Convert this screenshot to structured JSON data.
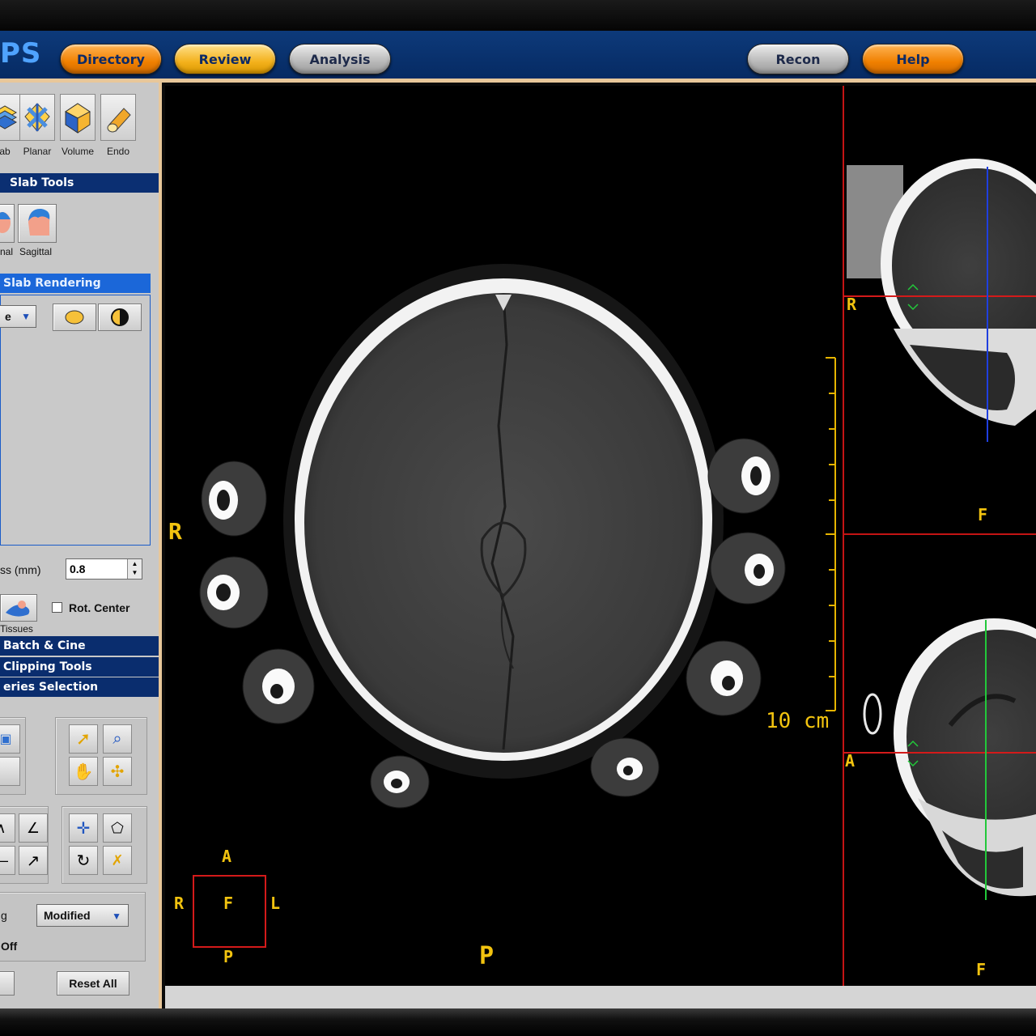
{
  "header": {
    "logo_text": "PS",
    "nav_buttons": [
      {
        "label": "Directory",
        "style": "orange"
      },
      {
        "label": "Review",
        "style": "yellow"
      },
      {
        "label": "Analysis",
        "style": "gray"
      },
      {
        "label": "Recon",
        "style": "gray"
      },
      {
        "label": "Help",
        "style": "orange"
      }
    ]
  },
  "modes": [
    {
      "label": "ab",
      "icon": "slab-icon"
    },
    {
      "label": "Planar",
      "icon": "planar-icon"
    },
    {
      "label": "Volume",
      "icon": "volume-icon"
    },
    {
      "label": "Endo",
      "icon": "endo-icon"
    }
  ],
  "slab_tools": {
    "title": "Slab Tools",
    "views": [
      {
        "label": "nal",
        "icon": "coronal-head-icon"
      },
      {
        "label": "Sagittal",
        "icon": "sagittal-head-icon"
      }
    ]
  },
  "slab_rendering": {
    "title": "Slab Rendering",
    "dropdown_value": "e",
    "thickness_label": "ss (mm)",
    "thickness_value": "0.8",
    "tissues_label": "Tissues",
    "rot_center_label": "Rot. Center",
    "rot_center_checked": false
  },
  "collapsed_sections": [
    "Batch & Cine",
    "Clipping Tools",
    "eries Selection"
  ],
  "bottom_controls": {
    "left_label": "g",
    "dropdown_value": "Modified",
    "off_label": "Off",
    "reset_label": "Reset All"
  },
  "viewer": {
    "axial": {
      "left": "R",
      "bottom": "P",
      "scale": "10 cm",
      "orientation_cube": {
        "top": "A",
        "left": "R",
        "center": "F",
        "right": "L",
        "bottom": "P"
      }
    },
    "coronal": {
      "left": "R",
      "bottom": "F"
    },
    "sagittal": {
      "left": "A",
      "bottom": "F"
    }
  },
  "colors": {
    "header_blue": "#0d3a7a",
    "accent_orange": "#f08000",
    "annotation_yellow": "#f2c30f",
    "section_blue": "#0b2f72",
    "crosshair_red": "#d41a1a",
    "crosshair_blue": "#1f3fe0",
    "crosshair_green": "#22c83a"
  }
}
